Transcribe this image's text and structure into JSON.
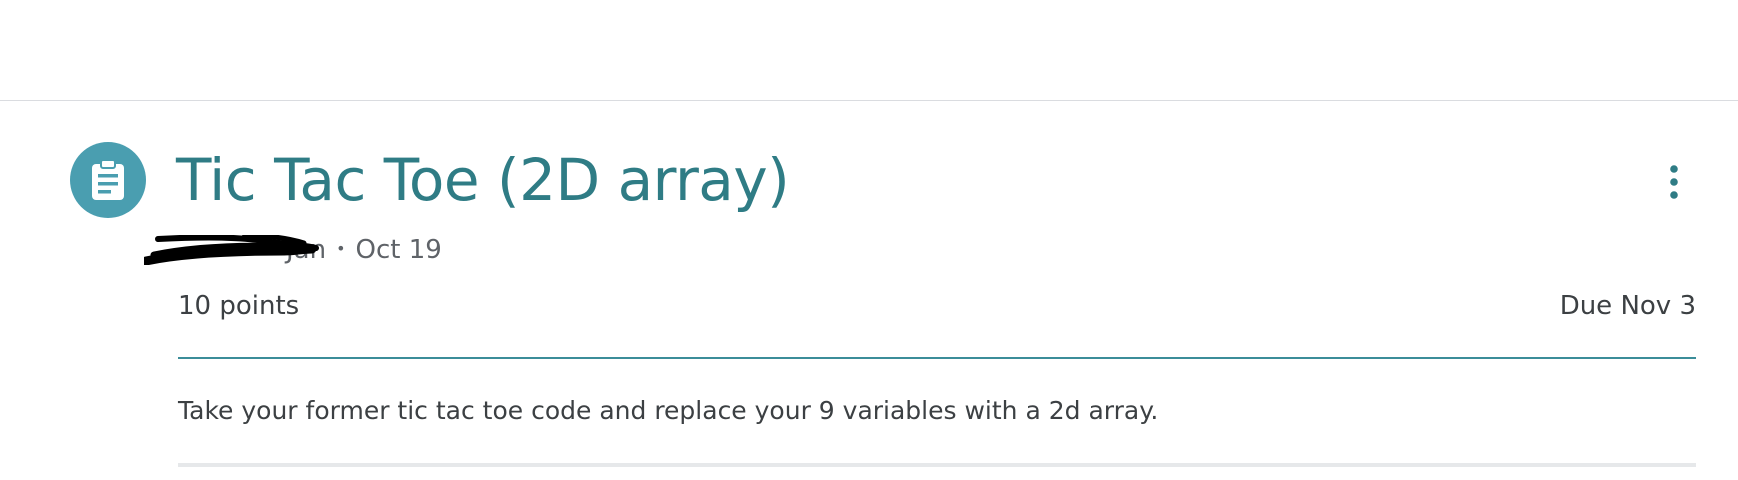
{
  "assignment": {
    "icon": "assignment-clipboard-icon",
    "title": "Tic Tac Toe (2D array)",
    "author": "Jan",
    "separator": "•",
    "posted_date": "Oct 19",
    "points": "10 points",
    "due": "Due Nov 3",
    "description": "Take your former tic tac toe code and replace your 9 variables with a 2d array."
  },
  "colors": {
    "accent": "#2f7c85",
    "icon_bg": "#4a9eb0",
    "divider": "#3b8d99",
    "text": "#3c4043",
    "muted": "#5f6368"
  },
  "more_menu": {
    "icon": "more-vert-icon"
  }
}
